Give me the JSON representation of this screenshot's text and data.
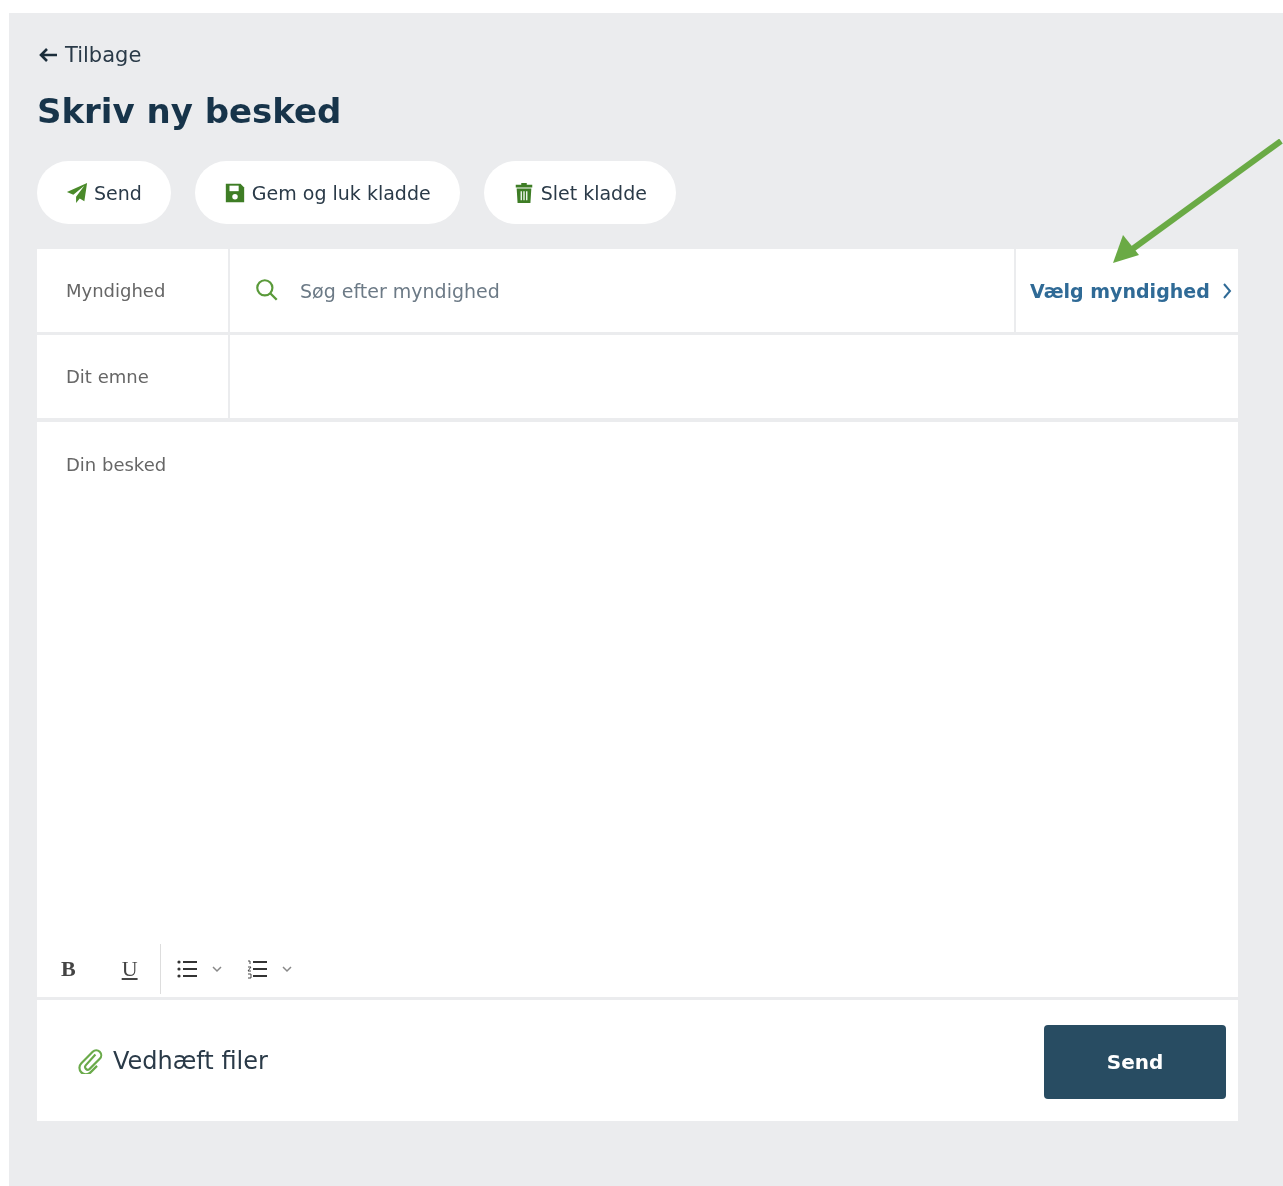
{
  "back_link": {
    "label": "Tilbage"
  },
  "title": "Skriv ny besked",
  "actions": [
    {
      "kind": "send",
      "label": "Send"
    },
    {
      "kind": "save",
      "label": "Gem og luk kladde"
    },
    {
      "kind": "delete",
      "label": "Slet kladde"
    }
  ],
  "form": {
    "authority": {
      "label": "Myndighed",
      "placeholder": "Søg efter myndighed",
      "select_link": "Vælg myndighed"
    },
    "subject": {
      "label": "Dit emne"
    },
    "message": {
      "placeholder": "Din besked"
    }
  },
  "editor_toolbar": [
    {
      "kind": "bold",
      "label": "B"
    },
    {
      "kind": "underline",
      "label": "U"
    },
    {
      "kind": "bullet-list"
    },
    {
      "kind": "numbered-list"
    }
  ],
  "attach_link": "Vedhæft filer",
  "submit_button": "Send"
}
